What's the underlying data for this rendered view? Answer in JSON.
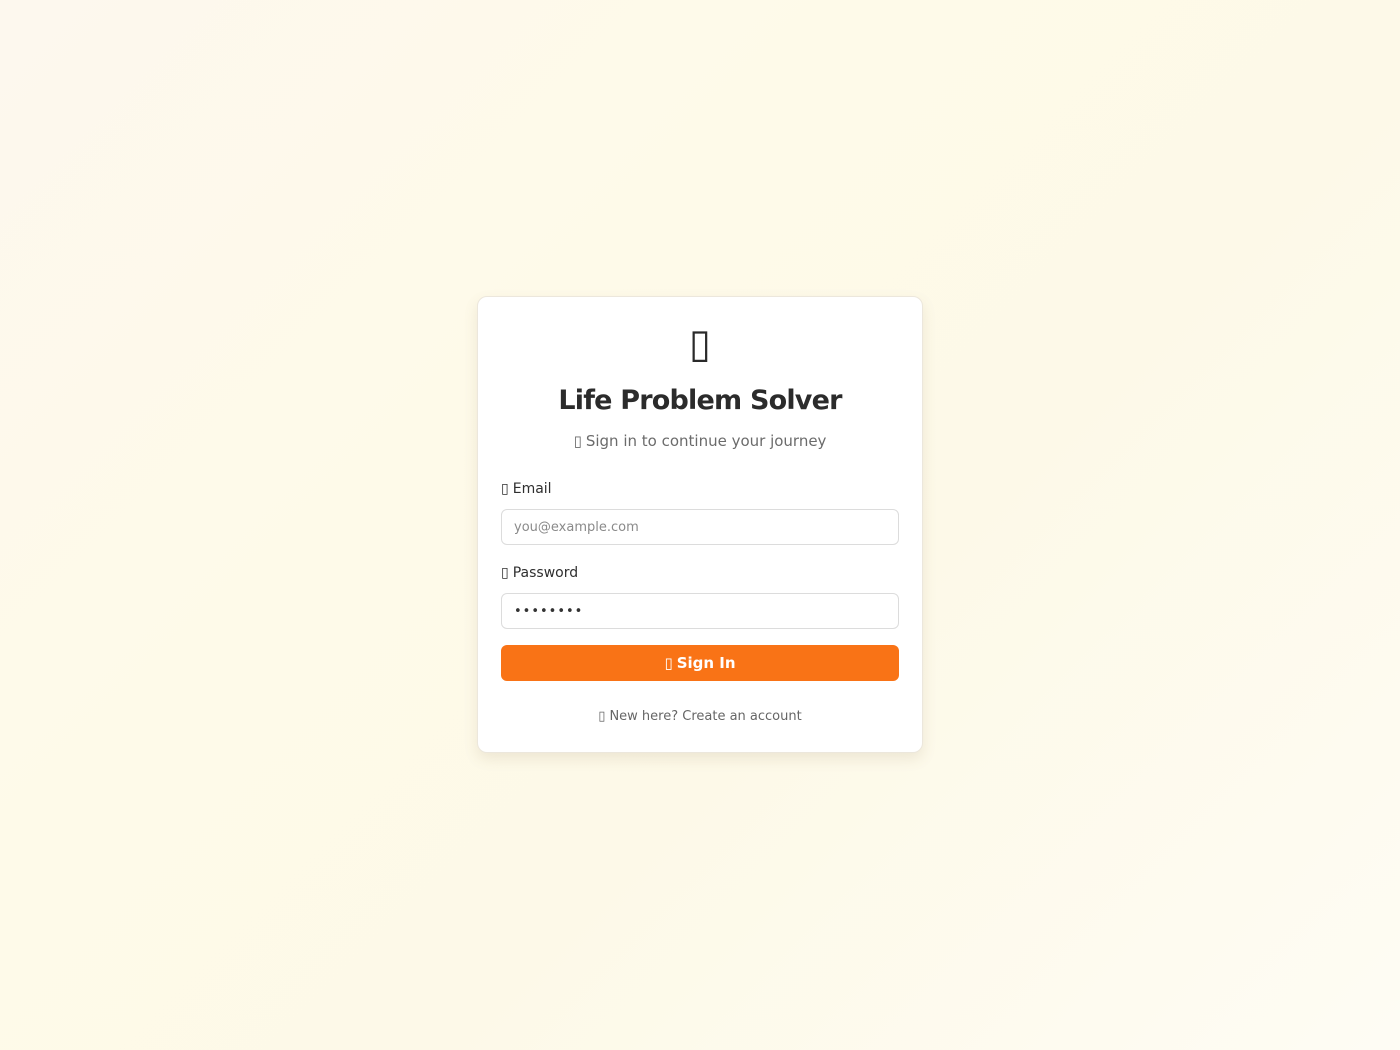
{
  "app": {
    "logo_glyph": "▯",
    "title": "Life Problem Solver",
    "subtitle": "Sign in to continue your journey",
    "subtitle_icon": "▯"
  },
  "form": {
    "email": {
      "icon": "▯",
      "label": "Email",
      "placeholder": "you@example.com",
      "value": ""
    },
    "password": {
      "icon": "▯",
      "label": "Password",
      "value": "••••••••"
    },
    "submit": {
      "icon": "▯",
      "label": "Sign In"
    },
    "signup": {
      "icon": "▯",
      "label": "New here? Create an account"
    }
  },
  "colors": {
    "accent": "#f97316",
    "background": "#fdf9ea",
    "card": "#ffffff"
  },
  "icons": {
    "logo": "app-logo-icon",
    "subtitle": "sparkle-icon",
    "email": "mail-icon",
    "password": "lock-icon",
    "submit": "sign-in-icon",
    "signup": "user-plus-icon"
  }
}
